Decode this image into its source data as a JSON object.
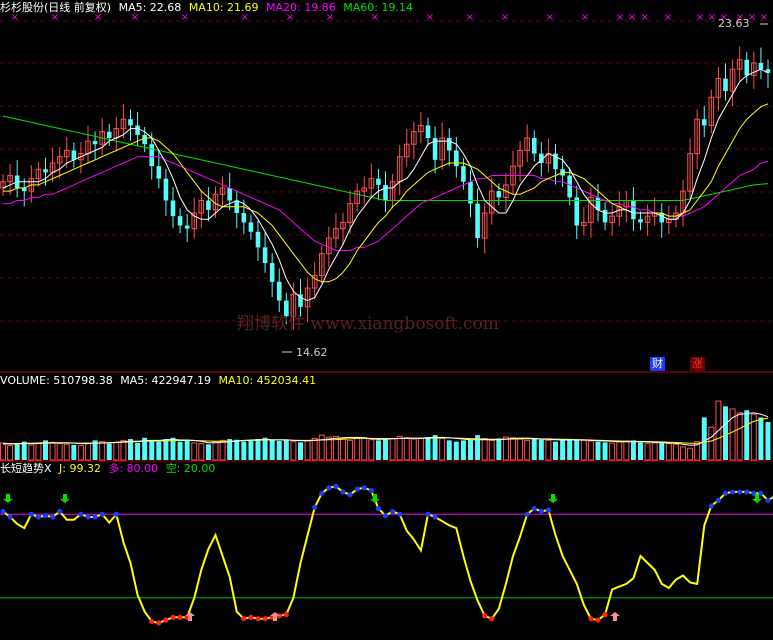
{
  "colors": {
    "background": "#000000",
    "up": "#ff5050",
    "down": "#54fcfc",
    "ma5": "#ffffff",
    "ma10": "#ffff00",
    "ma20": "#ff00ff",
    "ma60": "#00e000",
    "separator": "#b00000",
    "indicator_line": "#ffff00",
    "level_high": "#ff00ff",
    "level_low": "#00c000",
    "dot_high": "#1a3cff",
    "dot_low": "#ff2020",
    "arrow_down": "#00e000",
    "arrow_up": "#ff9090",
    "marker": "#ff00ff"
  },
  "header_main": {
    "title": "杉杉股份(日线 前复权)",
    "ma5": "MA5: 22.68",
    "ma10": "MA10: 21.69",
    "ma20": "MA20: 19.86",
    "ma60": "MA60: 19.14"
  },
  "header_volume": {
    "label": "VOLUME: 510798.38",
    "ma5": "MA5: 422947.19",
    "ma10": "MA10: 452034.41"
  },
  "header_indicator": {
    "name": "长短趋势X",
    "j": "J: 99.32",
    "duo": "多: 80.00",
    "kong": "空: 20.00"
  },
  "watermark": "翔博软件 www.xiangbosoft.com",
  "high_label": "23.63",
  "low_label": "14.62",
  "tags": {
    "cai": "财",
    "zhang": "涨"
  },
  "marker_glyph": "×",
  "chart_data": [
    {
      "type": "candlestick",
      "title": "杉杉股份(日线 前复权)",
      "ylim": [
        13.5,
        24.5
      ],
      "high": 23.63,
      "low": 14.62,
      "series_names": [
        "MA5",
        "MA10",
        "MA20",
        "MA60"
      ],
      "ma_values": {
        "MA5": 22.68,
        "MA10": 21.69,
        "MA20": 19.86,
        "MA60": 19.14
      },
      "closes": [
        19.2,
        19.4,
        19.0,
        18.9,
        19.3,
        19.6,
        19.5,
        19.8,
        20.0,
        20.2,
        19.9,
        20.1,
        20.5,
        20.4,
        20.8,
        20.6,
        20.9,
        21.2,
        21.0,
        20.7,
        20.4,
        19.7,
        19.3,
        18.6,
        18.1,
        17.8,
        17.7,
        18.2,
        18.6,
        18.3,
        18.8,
        19.0,
        18.6,
        18.2,
        17.9,
        17.6,
        17.1,
        16.6,
        16.0,
        15.4,
        14.9,
        15.6,
        15.2,
        15.8,
        16.2,
        16.9,
        17.4,
        17.7,
        17.9,
        18.5,
        18.9,
        19.0,
        19.3,
        19.1,
        18.6,
        19.2,
        20.0,
        20.4,
        20.8,
        21.0,
        20.6,
        19.9,
        20.6,
        20.2,
        19.7,
        19.2,
        18.5,
        17.4,
        18.2,
        18.9,
        18.7,
        19.1,
        19.7,
        20.2,
        20.6,
        20.1,
        19.8,
        20.1,
        19.6,
        19.4,
        18.7,
        17.8,
        17.9,
        18.7,
        18.3,
        17.9,
        18.1,
        18.4,
        18.6,
        18.0,
        17.9,
        18.1,
        18.2,
        17.9,
        18.0,
        18.2,
        18.9,
        20.1,
        21.2,
        21.0,
        21.9,
        22.5,
        22.1,
        22.8,
        23.1,
        22.6,
        23.0,
        22.8,
        22.68
      ],
      "ma5_values": [
        19.0,
        19.1,
        19.2,
        19.2,
        19.2,
        19.2,
        19.3,
        19.5,
        19.6,
        19.8,
        19.9,
        20.0,
        20.1,
        20.2,
        20.3,
        20.5,
        20.6,
        20.7,
        20.9,
        20.9,
        20.8,
        20.6,
        20.2,
        19.8,
        19.3,
        18.7,
        18.3,
        18.1,
        18.0,
        18.0,
        18.2,
        18.4,
        18.5,
        18.6,
        18.5,
        18.3,
        18.0,
        17.6,
        17.2,
        16.7,
        16.1,
        15.7,
        15.5,
        15.4,
        15.5,
        15.9,
        16.4,
        16.8,
        17.2,
        17.7,
        18.1,
        18.4,
        18.7,
        18.9,
        19.0,
        19.0,
        19.2,
        19.3,
        19.6,
        20.0,
        20.4,
        20.5,
        20.5,
        20.5,
        20.4,
        20.1,
        19.7,
        19.1,
        18.6,
        18.4,
        18.2,
        18.2,
        18.6,
        19.1,
        19.4,
        19.7,
        19.9,
        20.1,
        20.0,
        19.9,
        19.6,
        19.2,
        18.8,
        18.5,
        18.3,
        18.2,
        18.2,
        18.3,
        18.3,
        18.2,
        18.2,
        18.2,
        18.2,
        18.1,
        18.0,
        18.0,
        18.2,
        18.6,
        19.3,
        19.9,
        20.6,
        21.2,
        21.6,
        22.0,
        22.4,
        22.6,
        22.7,
        22.8,
        22.68
      ],
      "ma10_values": [
        18.9,
        18.9,
        19.0,
        19.0,
        19.1,
        19.1,
        19.2,
        19.3,
        19.4,
        19.5,
        19.6,
        19.7,
        19.8,
        19.9,
        20.0,
        20.1,
        20.2,
        20.3,
        20.4,
        20.5,
        20.6,
        20.6,
        20.5,
        20.3,
        20.1,
        19.8,
        19.5,
        19.2,
        18.9,
        18.7,
        18.5,
        18.4,
        18.4,
        18.4,
        18.4,
        18.3,
        18.2,
        18.0,
        17.8,
        17.5,
        17.2,
        16.9,
        16.6,
        16.3,
        16.1,
        16.0,
        16.0,
        16.1,
        16.3,
        16.6,
        17.0,
        17.3,
        17.6,
        17.9,
        18.1,
        18.4,
        18.6,
        18.9,
        19.1,
        19.3,
        19.5,
        19.6,
        19.7,
        19.8,
        19.8,
        19.8,
        19.7,
        19.6,
        19.4,
        19.2,
        19.0,
        18.9,
        18.8,
        18.8,
        18.9,
        19.0,
        19.2,
        19.3,
        19.4,
        19.5,
        19.5,
        19.4,
        19.3,
        19.1,
        18.9,
        18.7,
        18.5,
        18.4,
        18.3,
        18.2,
        18.2,
        18.2,
        18.2,
        18.2,
        18.1,
        18.1,
        18.2,
        18.3,
        18.6,
        18.9,
        19.2,
        19.7,
        20.1,
        20.5,
        20.9,
        21.2,
        21.4,
        21.6,
        21.69
      ],
      "ma20_values": [
        18.5,
        18.5,
        18.6,
        18.6,
        18.7,
        18.7,
        18.8,
        18.8,
        18.9,
        19.0,
        19.1,
        19.2,
        19.3,
        19.4,
        19.5,
        19.6,
        19.7,
        19.8,
        19.9,
        20.0,
        20.0,
        20.0,
        20.0,
        19.9,
        19.8,
        19.7,
        19.6,
        19.5,
        19.4,
        19.3,
        19.2,
        19.1,
        19.0,
        18.9,
        18.8,
        18.7,
        18.6,
        18.5,
        18.4,
        18.3,
        18.1,
        17.9,
        17.7,
        17.5,
        17.3,
        17.2,
        17.1,
        17.0,
        17.0,
        17.0,
        17.1,
        17.1,
        17.2,
        17.3,
        17.5,
        17.7,
        17.9,
        18.1,
        18.3,
        18.5,
        18.6,
        18.7,
        18.8,
        18.9,
        19.0,
        19.1,
        19.2,
        19.3,
        19.3,
        19.4,
        19.4,
        19.4,
        19.4,
        19.4,
        19.4,
        19.4,
        19.3,
        19.3,
        19.2,
        19.2,
        19.1,
        19.0,
        18.9,
        18.8,
        18.7,
        18.6,
        18.5,
        18.5,
        18.4,
        18.4,
        18.3,
        18.3,
        18.2,
        18.2,
        18.1,
        18.1,
        18.1,
        18.2,
        18.3,
        18.4,
        18.6,
        18.8,
        19.0,
        19.2,
        19.4,
        19.5,
        19.6,
        19.8,
        19.86
      ],
      "ma60_values": [
        21.3,
        21.25,
        21.2,
        21.15,
        21.1,
        21.05,
        21.0,
        20.95,
        20.9,
        20.85,
        20.8,
        20.75,
        20.7,
        20.65,
        20.6,
        20.55,
        20.5,
        20.45,
        20.4,
        20.35,
        20.3,
        20.25,
        20.2,
        20.15,
        20.1,
        20.05,
        20.0,
        19.95,
        19.9,
        19.85,
        19.8,
        19.75,
        19.7,
        19.65,
        19.6,
        19.55,
        19.5,
        19.45,
        19.4,
        19.35,
        19.3,
        19.25,
        19.2,
        19.15,
        19.1,
        19.05,
        19.0,
        18.95,
        18.9,
        18.85,
        18.8,
        18.75,
        18.7,
        18.65,
        18.6,
        18.6,
        18.6,
        18.6,
        18.6,
        18.6,
        18.6,
        18.6,
        18.6,
        18.6,
        18.6,
        18.6,
        18.6,
        18.6,
        18.6,
        18.6,
        18.6,
        18.6,
        18.6,
        18.6,
        18.6,
        18.6,
        18.6,
        18.6,
        18.6,
        18.6,
        18.6,
        18.6,
        18.6,
        18.6,
        18.6,
        18.6,
        18.6,
        18.6,
        18.6,
        18.6,
        18.6,
        18.6,
        18.6,
        18.6,
        18.6,
        18.6,
        18.6,
        18.65,
        18.7,
        18.75,
        18.8,
        18.85,
        18.9,
        18.95,
        19.0,
        19.05,
        19.1,
        19.12,
        19.14
      ]
    },
    {
      "type": "bar",
      "title": "VOLUME",
      "ylim": [
        0,
        1100000
      ],
      "series_names": [
        "VOLUME",
        "MA5",
        "MA10"
      ],
      "current": {
        "VOLUME": 510798.38,
        "MA5": 422947.19,
        "MA10": 452034.41
      },
      "values": [
        260000,
        220000,
        250000,
        280000,
        230000,
        260000,
        300000,
        270000,
        250000,
        240000,
        230000,
        220000,
        260000,
        300000,
        280000,
        250000,
        270000,
        300000,
        320000,
        260000,
        340000,
        300000,
        280000,
        320000,
        340000,
        280000,
        300000,
        260000,
        250000,
        240000,
        280000,
        300000,
        320000,
        310000,
        280000,
        300000,
        320000,
        340000,
        300000,
        290000,
        310000,
        280000,
        270000,
        290000,
        330000,
        380000,
        350000,
        360000,
        330000,
        300000,
        330000,
        340000,
        310000,
        300000,
        320000,
        330000,
        360000,
        340000,
        320000,
        330000,
        350000,
        380000,
        330000,
        300000,
        280000,
        300000,
        310000,
        380000,
        330000,
        300000,
        330000,
        350000,
        340000,
        320000,
        300000,
        330000,
        310000,
        300000,
        280000,
        300000,
        320000,
        310000,
        300000,
        290000,
        280000,
        270000,
        260000,
        280000,
        290000,
        300000,
        270000,
        250000,
        260000,
        280000,
        250000,
        240000,
        200000,
        180000,
        280000,
        650000,
        500000,
        900000,
        820000,
        780000,
        720000,
        760000,
        700000,
        650000,
        580000
      ],
      "ma5_values": [
        250000,
        250000,
        250000,
        255000,
        255000,
        260000,
        265000,
        265000,
        265000,
        265000,
        260000,
        250000,
        250000,
        255000,
        260000,
        265000,
        270000,
        280000,
        285000,
        285000,
        295000,
        300000,
        300000,
        305000,
        315000,
        305000,
        305000,
        300000,
        285000,
        265000,
        265000,
        270000,
        280000,
        290000,
        300000,
        305000,
        310000,
        315000,
        310000,
        310000,
        310000,
        300000,
        295000,
        295000,
        300000,
        310000,
        320000,
        330000,
        340000,
        345000,
        345000,
        340000,
        325000,
        315000,
        320000,
        325000,
        330000,
        335000,
        335000,
        335000,
        340000,
        345000,
        345000,
        340000,
        330000,
        320000,
        310000,
        310000,
        310000,
        310000,
        310000,
        320000,
        330000,
        335000,
        335000,
        330000,
        320000,
        315000,
        310000,
        305000,
        305000,
        305000,
        305000,
        300000,
        295000,
        290000,
        285000,
        280000,
        280000,
        280000,
        280000,
        275000,
        270000,
        265000,
        260000,
        255000,
        240000,
        225000,
        230000,
        290000,
        350000,
        450000,
        550000,
        650000,
        700000,
        710000,
        720000,
        700000,
        660000
      ],
      "ma10_values": [
        245000,
        245000,
        245000,
        248000,
        250000,
        252000,
        255000,
        258000,
        260000,
        260000,
        258000,
        258000,
        258000,
        260000,
        262000,
        264000,
        266000,
        270000,
        275000,
        280000,
        285000,
        288000,
        290000,
        292000,
        295000,
        298000,
        298000,
        297000,
        295000,
        290000,
        285000,
        285000,
        288000,
        290000,
        295000,
        300000,
        303000,
        305000,
        305000,
        305000,
        305000,
        303000,
        300000,
        300000,
        302000,
        305000,
        308000,
        312000,
        318000,
        325000,
        330000,
        332000,
        330000,
        328000,
        327000,
        327000,
        328000,
        330000,
        330000,
        330000,
        332000,
        335000,
        337000,
        337000,
        335000,
        332000,
        327000,
        323000,
        320000,
        318000,
        316000,
        318000,
        320000,
        323000,
        325000,
        325000,
        323000,
        322000,
        320000,
        318000,
        315000,
        312000,
        310000,
        306000,
        302000,
        298000,
        294000,
        290000,
        288000,
        286000,
        284000,
        282000,
        279000,
        276000,
        272000,
        268000,
        262000,
        256000,
        254000,
        270000,
        290000,
        330000,
        380000,
        430000,
        480000,
        540000,
        590000,
        620000,
        640000
      ]
    },
    {
      "type": "line",
      "title": "长短趋势X",
      "ylim": [
        -6,
        106
      ],
      "series_names": [
        "J",
        "多",
        "空"
      ],
      "current": {
        "J": 99.32,
        "多": 80.0,
        "空": 20.0
      },
      "levels": [
        80,
        20
      ],
      "values": [
        82,
        78,
        73,
        70,
        80,
        78,
        79,
        78,
        82,
        76,
        76,
        80,
        78,
        78,
        80,
        74,
        80,
        60,
        45,
        22,
        10,
        3,
        2,
        4,
        6,
        6,
        6,
        20,
        40,
        55,
        65,
        50,
        35,
        10,
        5,
        6,
        5,
        5,
        6,
        7,
        8,
        20,
        45,
        65,
        85,
        95,
        99,
        100,
        96,
        94,
        98,
        99,
        97,
        84,
        79,
        82,
        80,
        68,
        62,
        54,
        80,
        78,
        75,
        72,
        70,
        50,
        32,
        18,
        7,
        5,
        12,
        30,
        50,
        64,
        80,
        84,
        82,
        83,
        65,
        50,
        40,
        30,
        15,
        5,
        4,
        8,
        26,
        28,
        30,
        34,
        50,
        45,
        40,
        30,
        27,
        33,
        36,
        31,
        30,
        72,
        86,
        90,
        95,
        96,
        96,
        96,
        95,
        95,
        90,
        93,
        92,
        99.32
      ]
    }
  ]
}
